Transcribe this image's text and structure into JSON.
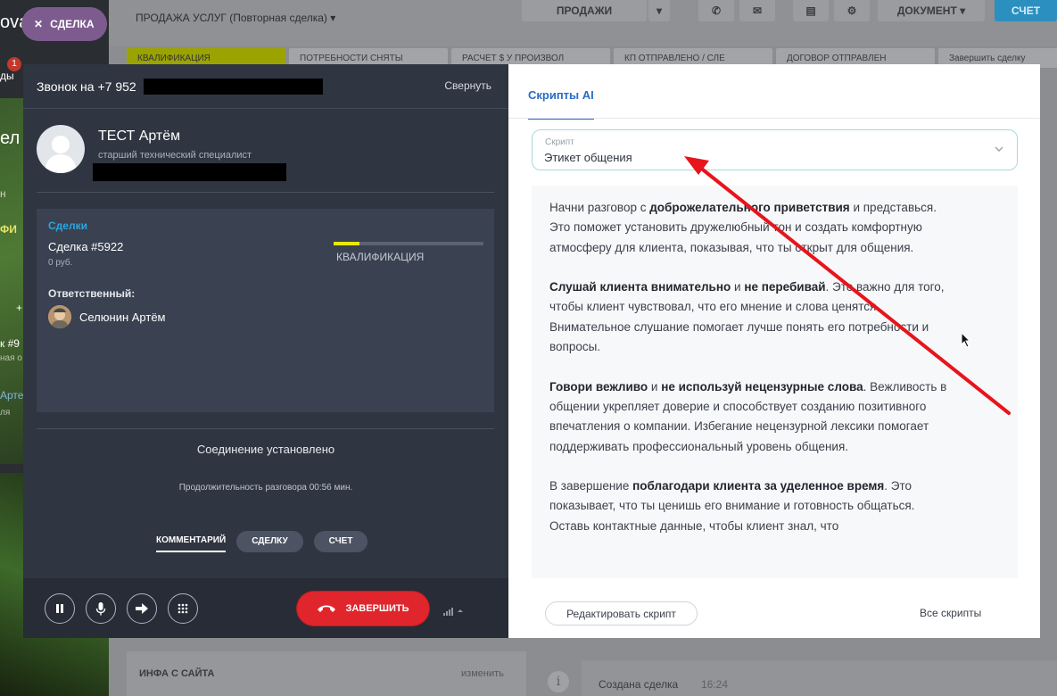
{
  "background": {
    "left_nav": {
      "deal_pill": "СДЕЛКА",
      "brand_fragment": "ova",
      "badge_count": "1",
      "fragments": [
        "ды",
        "ел",
        "н",
        "ФИ",
        "+",
        "к #9",
        "ная о",
        "Арте",
        "ля"
      ]
    },
    "breadcrumb": "ПРОДАЖА УСЛУГ (Повторная сделка)",
    "buttons": {
      "sales": "ПРОДАЖИ",
      "document": "ДОКУМЕНТ",
      "invoice": "СЧЕТ"
    },
    "stages": [
      "КВАЛИФИКАЦИЯ",
      "ПОТРЕБНОСТИ СНЯТЫ",
      "РАСЧЕТ $ У ПРОИЗВОЛ",
      "КП ОТПРАВЛЕНО / СЛЕ",
      "ДОГОВОР ОТПРАВЛЕН",
      "Завершить сделку"
    ],
    "info_card": {
      "title": "ИНФА С САЙТА",
      "edit": "изменить"
    },
    "feed": {
      "event": "Создана сделка",
      "time": "16:24"
    }
  },
  "call": {
    "number_prefix": "Звонок на +7 952",
    "collapse": "Свернуть",
    "contact": {
      "name": "ТЕСТ Артём",
      "role": "старший технический специалист"
    },
    "deals_label": "Сделки",
    "deal": {
      "name": "Сделка #5922",
      "price": "0 руб.",
      "stage": "КВАЛИФИКАЦИЯ",
      "stage_progress": 0.17
    },
    "responsible_label": "Ответственный:",
    "responsible_name": "Селюнин Артём",
    "status": "Соединение установлено",
    "duration": "Продолжительность разговора 00:56 мин.",
    "tabs": [
      "КОММЕНТАРИЙ",
      "СДЕЛКУ",
      "СЧЕТ"
    ],
    "end_label": "ЗАВЕРШИТЬ",
    "icons": [
      "pause-icon",
      "microphone-icon",
      "forward-icon",
      "dialpad-icon",
      "phone-hangup-icon",
      "signal-icon"
    ]
  },
  "panel": {
    "tab": "Скрипты AI",
    "select": {
      "caption": "Скрипт",
      "value": "Этикет общения"
    },
    "script": [
      {
        "p1": "Начни разговор с ",
        "b1": "доброжелательного приветствия",
        "p2": " и представься. Это поможет установить дружелюбный тон и создать комфортную атмосферу для клиента, показывая, что ты открыт для общения."
      },
      {
        "p1": "",
        "b1": "Слушай клиента внимательно",
        "p2": " и ",
        "b2": "не перебивай",
        "p3": ". Это важно для того, чтобы клиент чувствовал, что его мнение и слова ценятся. Внимательное слушание помогает лучше понять его потребности и вопросы."
      },
      {
        "p1": "",
        "b1": "Говори вежливо",
        "p2": " и ",
        "b2": "не используй нецензурные слова",
        "p3": ". Вежливость в общении укрепляет доверие и способствует созданию позитивного впечатления о компании. Избегание нецензурной лексики помогает поддерживать профессиональный уровень общения."
      },
      {
        "p1": "В завершение ",
        "b1": "поблагодари клиента за уделенное время",
        "p2": ". Это показывает, что ты ценишь его внимание и готовность общаться. Оставь  контактные данные, чтобы клиент знал, что"
      }
    ],
    "edit_button": "Редактировать скрипт",
    "all_scripts": "Все скрипты"
  },
  "colors": {
    "accent_blue": "#2b6cc8",
    "end_call_red": "#e0262c",
    "annotation_arrow": "#e8141c",
    "stage_yellow": "#e6ea00",
    "deals_blue": "#2ba6de"
  }
}
